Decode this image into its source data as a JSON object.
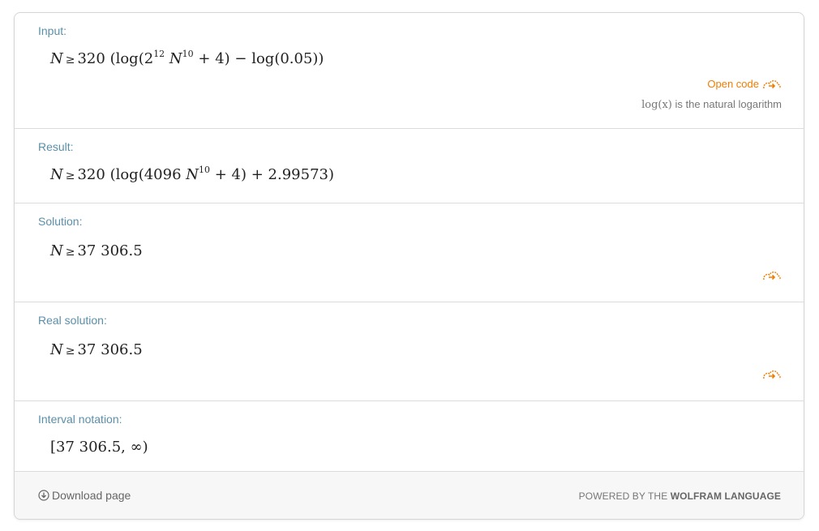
{
  "pods": {
    "input": {
      "title": "Input:",
      "expr": {
        "lhs": "N",
        "rel": "≥",
        "coef": "320",
        "open": " (log(2",
        "exp1": "12",
        "mid": " N",
        "exp2": "10",
        "tail": " + 4) − log(0.05))"
      },
      "open_code": "Open code",
      "note_fn": "log(x)",
      "note_text": " is the natural logarithm"
    },
    "result": {
      "title": "Result:",
      "expr": {
        "lhs": "N",
        "rel": "≥",
        "coef": "320",
        "open": " (log(4096",
        "mid": " N",
        "exp": "10",
        "tail": " + 4) + 2.99573)"
      }
    },
    "solution": {
      "title": "Solution:",
      "expr": {
        "lhs": "N",
        "rel": "≥",
        "value": "37 306.5"
      }
    },
    "real_solution": {
      "title": "Real solution:",
      "expr": {
        "lhs": "N",
        "rel": "≥",
        "value": "37 306.5"
      }
    },
    "interval": {
      "title": "Interval notation:",
      "value": "[37 306.5, ∞)"
    }
  },
  "footer": {
    "download": "Download page",
    "powered_prefix": "POWERED BY THE ",
    "powered_brand": "WOLFRAM LANGUAGE"
  },
  "colors": {
    "accent": "#f07d00",
    "pod_title": "#5b8fa8"
  },
  "icons": [
    "cloud-arrow-icon",
    "download-icon"
  ]
}
